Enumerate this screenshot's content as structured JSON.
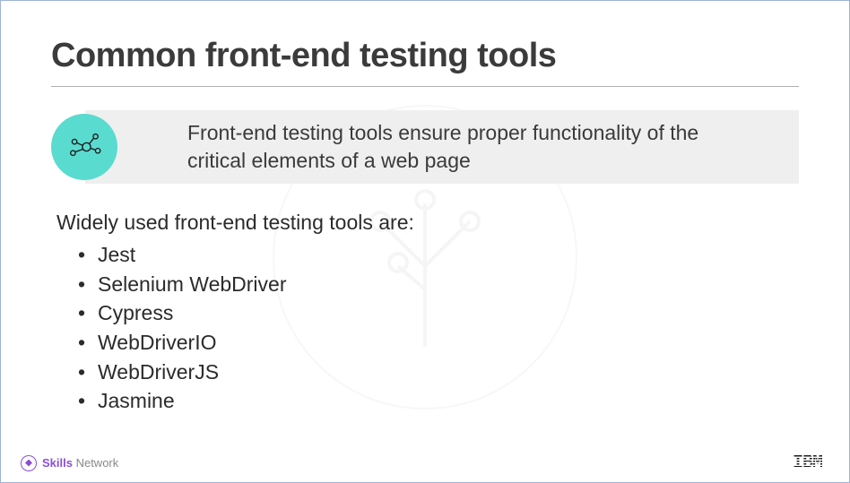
{
  "slide": {
    "title": "Common front-end testing tools",
    "callout": "Front-end testing tools ensure proper functionality of the critical elements of a web page",
    "intro": "Widely used front-end testing tools are:",
    "bullets": [
      "Jest",
      "Selenium WebDriver",
      "Cypress",
      "WebDriverIO",
      "WebDriverJS",
      "Jasmine"
    ]
  },
  "footer": {
    "brand_bold": "Skills",
    "brand_rest": " Network",
    "logo": "IBM"
  }
}
